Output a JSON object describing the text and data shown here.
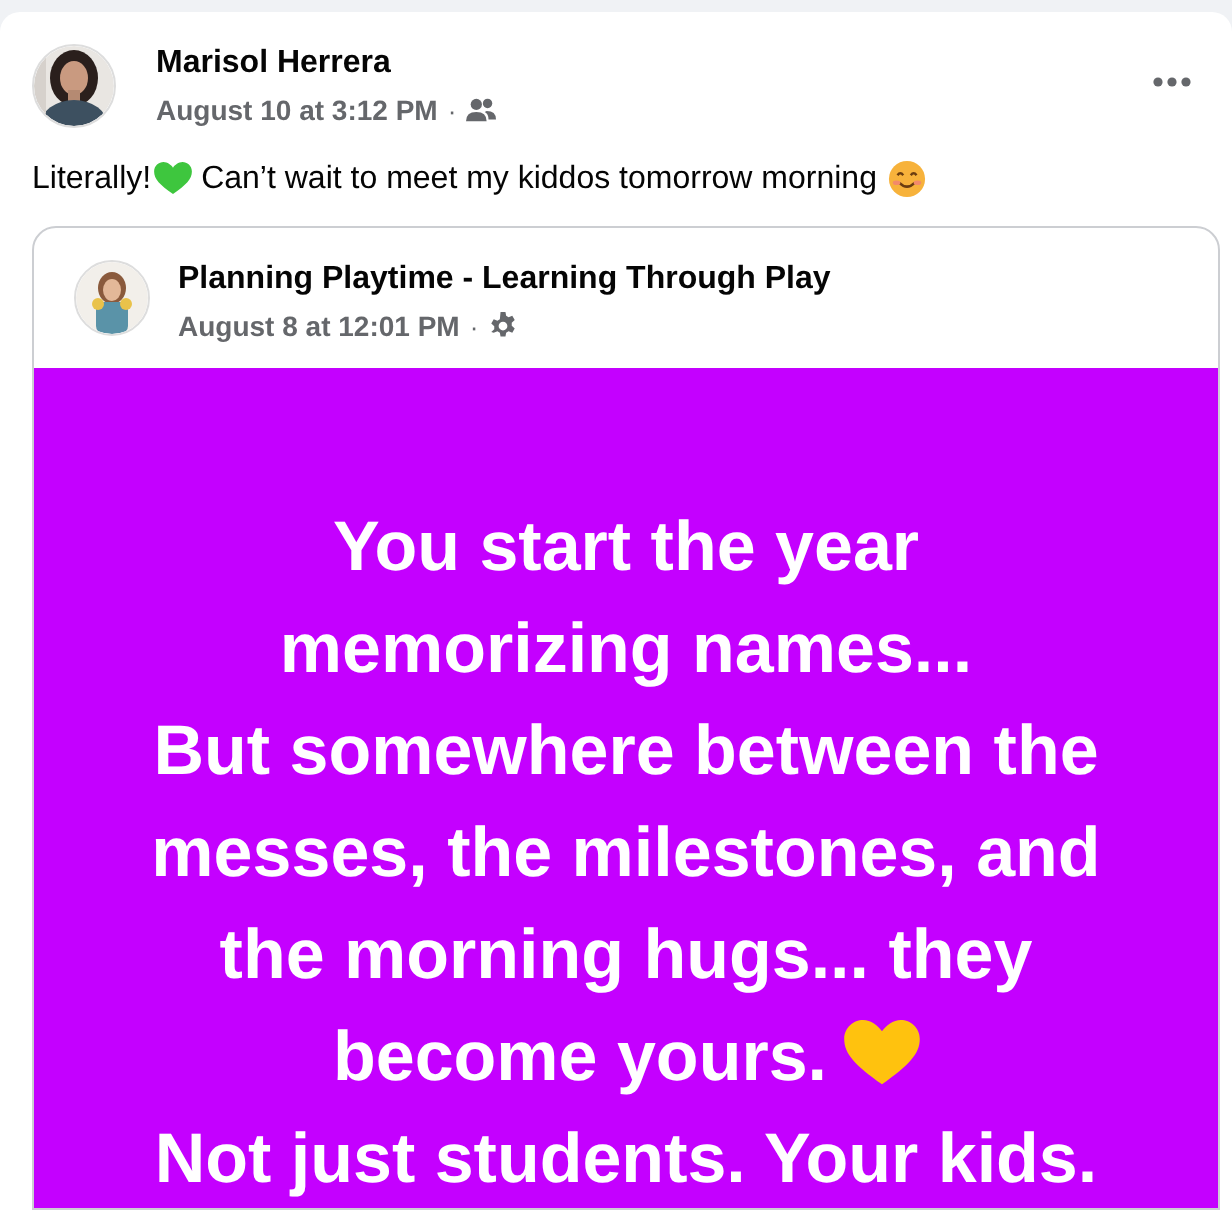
{
  "post": {
    "author": "Marisol Herrera",
    "timestamp": "August 10 at 3:12 PM",
    "separator": "·",
    "audience": {
      "kind": "friends"
    },
    "body": [
      {
        "kind": "text",
        "text": "Literally!"
      },
      {
        "kind": "heart",
        "color": "#3ec63e"
      },
      {
        "kind": "text",
        "text": "Can’t wait to meet my kiddos tomorrow morning"
      },
      {
        "kind": "smile"
      }
    ],
    "shared": {
      "author": "Planning Playtime - Learning Through Play",
      "timestamp": "August 8 at 12:01 PM",
      "separator": "·",
      "audience": {
        "kind": "gear"
      },
      "background": {
        "kind": "solid",
        "color": "#c400ff"
      },
      "paragraphs": [
        {
          "text": "You start the year memorizing names..."
        },
        {
          "text": "But somewhere between the messes, the milestones, and the morning hugs... they become yours.",
          "emoji": {
            "kind": "heart",
            "color": "#ffc20e"
          }
        },
        {
          "text": "Not just students. Your kids."
        }
      ]
    }
  }
}
